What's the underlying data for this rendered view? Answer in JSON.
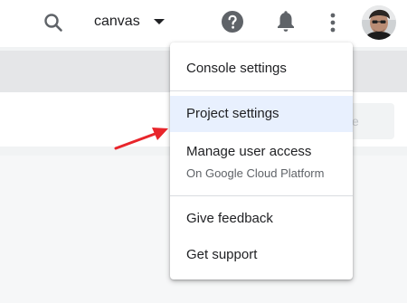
{
  "header": {
    "search_icon": "search-icon",
    "project_name": "canvas",
    "help_icon": "help-icon",
    "notifications_icon": "bell-icon",
    "more_icon": "more-vert-icon",
    "avatar": "user-avatar"
  },
  "toolbar": {
    "save_label": "ve"
  },
  "menu": {
    "items": [
      {
        "label": "Console settings"
      },
      {
        "label": "Project settings",
        "selected": true
      },
      {
        "label": "Manage user access",
        "sublabel": "On Google Cloud Platform"
      },
      {
        "label": "Give feedback"
      },
      {
        "label": "Get support"
      }
    ]
  },
  "colors": {
    "accent_arrow": "#e8252b",
    "selected_bg": "#e8f0fe",
    "menu_text": "#202124",
    "subtext": "#5f6368"
  }
}
